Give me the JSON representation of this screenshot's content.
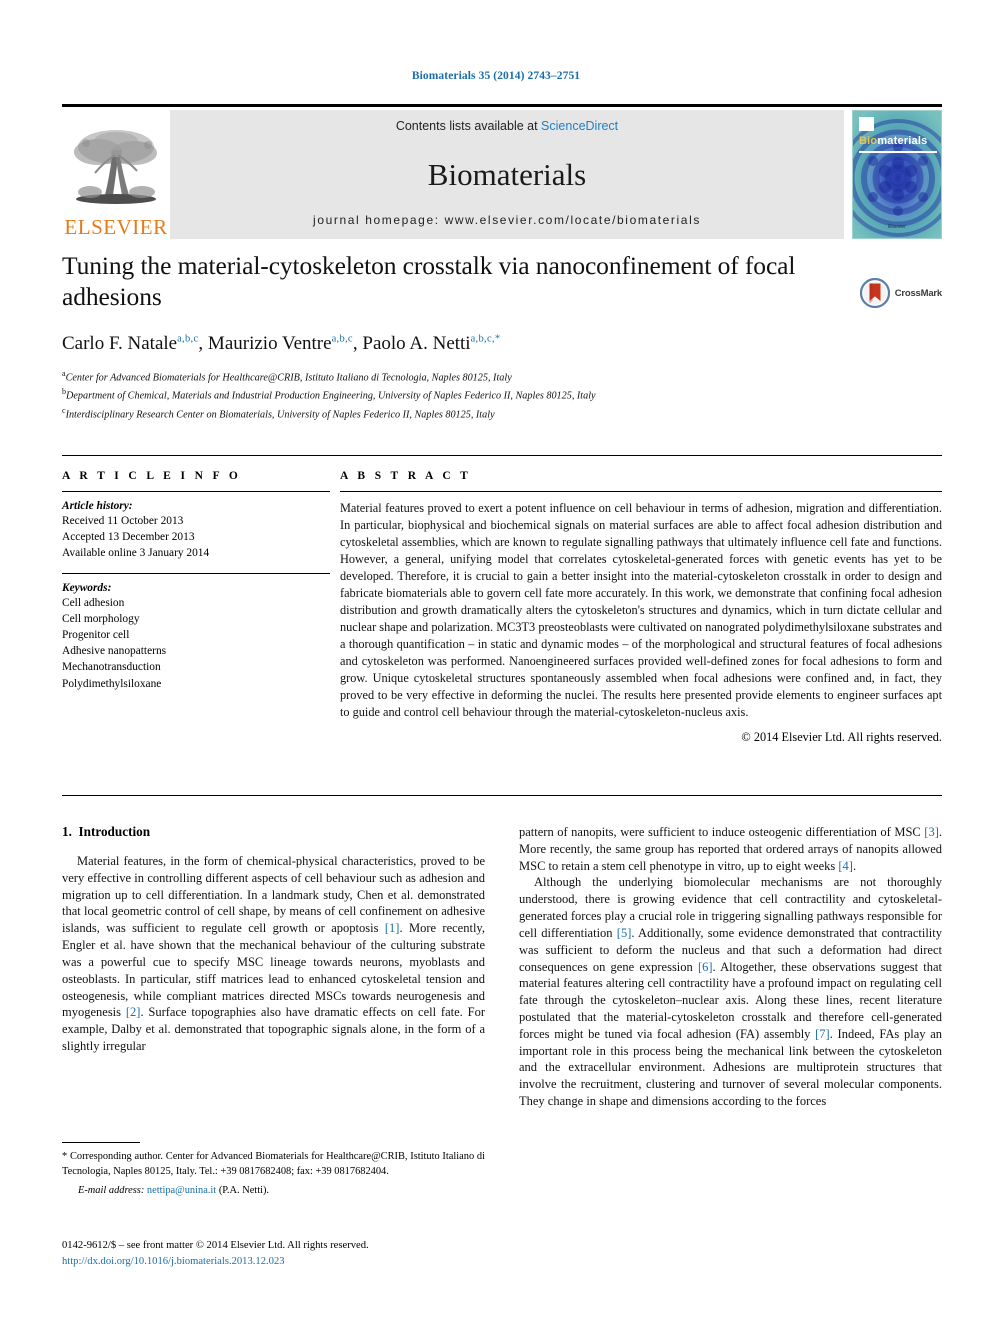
{
  "running_head": "Biomaterials 35 (2014) 2743–2751",
  "masthead": {
    "publisher": "ELSEVIER",
    "contents_prefix": "Contents lists available at ",
    "contents_link": "ScienceDirect",
    "journal_name": "Biomaterials",
    "homepage": "journal homepage: www.elsevier.com/locate/biomaterials",
    "cover": {
      "title_part1": "Bio",
      "title_part2": "materials",
      "footer": "Elsevier"
    }
  },
  "article": {
    "title": "Tuning the material-cytoskeleton crosstalk via nanoconfinement of focal adhesions",
    "crossmark_label": "CrossMark",
    "authors": [
      {
        "name": "Carlo F. Natale",
        "marks": "a,b,c",
        "sep": ", "
      },
      {
        "name": "Maurizio Ventre",
        "marks": "a,b,c",
        "sep": ", "
      },
      {
        "name": "Paolo A. Netti",
        "marks": "a,b,c,*",
        "sep": ""
      }
    ],
    "affiliations": [
      {
        "mark": "a",
        "text": "Center for Advanced Biomaterials for Healthcare@CRIB, Istituto Italiano di Tecnologia, Naples 80125, Italy"
      },
      {
        "mark": "b",
        "text": "Department of Chemical, Materials and Industrial Production Engineering, University of Naples Federico II, Naples 80125, Italy"
      },
      {
        "mark": "c",
        "text": "Interdisciplinary Research Center on Biomaterials, University of Naples Federico II, Naples 80125, Italy"
      }
    ]
  },
  "article_info": {
    "heading": "A R T I C L E  I N F O",
    "history_label": "Article history:",
    "history": [
      "Received 11 October 2013",
      "Accepted 13 December 2013",
      "Available online 3 January 2014"
    ],
    "keywords_label": "Keywords:",
    "keywords": [
      "Cell adhesion",
      "Cell morphology",
      "Progenitor cell",
      "Adhesive nanopatterns",
      "Mechanotransduction",
      "Polydimethylsiloxane"
    ]
  },
  "abstract": {
    "heading": "A B S T R A C T",
    "body": "Material features proved to exert a potent influence on cell behaviour in terms of adhesion, migration and differentiation. In particular, biophysical and biochemical signals on material surfaces are able to affect focal adhesion distribution and cytoskeletal assemblies, which are known to regulate signalling pathways that ultimately influence cell fate and functions. However, a general, unifying model that correlates cytoskeletal-generated forces with genetic events has yet to be developed. Therefore, it is crucial to gain a better insight into the material-cytoskeleton crosstalk in order to design and fabricate biomaterials able to govern cell fate more accurately. In this work, we demonstrate that confining focal adhesion distribution and growth dramatically alters the cytoskeleton's structures and dynamics, which in turn dictate cellular and nuclear shape and polarization. MC3T3 preosteoblasts were cultivated on nanograted polydimethylsiloxane substrates and a thorough quantification – in static and dynamic modes – of the morphological and structural features of focal adhesions and cytoskeleton was performed. Nanoengineered surfaces provided well-defined zones for focal adhesions to form and grow. Unique cytoskeletal structures spontaneously assembled when focal adhesions were confined and, in fact, they proved to be very effective in deforming the nuclei. The results here presented provide elements to engineer surfaces apt to guide and control cell behaviour through the material-cytoskeleton-nucleus axis.",
    "copyright": "© 2014 Elsevier Ltd. All rights reserved."
  },
  "introduction": {
    "section_number": "1.",
    "section_title": "Introduction",
    "left_paragraph_1_a": "Material features, in the form of chemical-physical characteristics, proved to be very effective in controlling different aspects of cell behaviour such as adhesion and migration up to cell differentiation. In a landmark study, Chen et al. demonstrated that local geometric control of cell shape, by means of cell confinement on adhesive islands, was sufficient to regulate cell growth or apoptosis ",
    "ref_1": "[1]",
    "left_paragraph_1_b": ". More recently, Engler et al. have shown that the mechanical behaviour of the culturing substrate was a powerful cue to specify MSC lineage towards neurons, myoblasts and osteoblasts. In particular, stiff matrices lead to enhanced cytoskeletal tension and osteogenesis, while compliant matrices directed MSCs towards neurogenesis and myogenesis ",
    "ref_2": "[2]",
    "left_paragraph_1_c": ". Surface topographies also have dramatic effects on cell fate. For example, Dalby et al. demonstrated that topographic signals alone, in the form of a slightly irregular",
    "right_paragraph_1_a": "pattern of nanopits, were sufficient to induce osteogenic differentiation of MSC ",
    "ref_3": "[3]",
    "right_paragraph_1_b": ". More recently, the same group has reported that ordered arrays of nanopits allowed MSC to retain a stem cell phenotype in vitro, up to eight weeks ",
    "ref_4": "[4]",
    "right_paragraph_1_c": ".",
    "right_paragraph_2_a": "Although the underlying biomolecular mechanisms are not thoroughly understood, there is growing evidence that cell contractility and cytoskeletal-generated forces play a crucial role in triggering signalling pathways responsible for cell differentiation ",
    "ref_5": "[5]",
    "right_paragraph_2_b": ". Additionally, some evidence demonstrated that contractility was sufficient to deform the nucleus and that such a deformation had direct consequences on gene expression ",
    "ref_6": "[6]",
    "right_paragraph_2_c": ". Altogether, these observations suggest that material features altering cell contractility have a profound impact on regulating cell fate through the cytoskeleton–nuclear axis. Along these lines, recent literature postulated that the material-cytoskeleton crosstalk and therefore cell-generated forces might be tuned via focal adhesion (FA) assembly ",
    "ref_7": "[7]",
    "right_paragraph_2_d": ". Indeed, FAs play an important role in this process being the mechanical link between the cytoskeleton and the extracellular environment. Adhesions are multiprotein structures that involve the recruitment, clustering and turnover of several molecular components. They change in shape and dimensions according to the forces"
  },
  "footnote": {
    "text": "* Corresponding author. Center for Advanced Biomaterials for Healthcare@CRIB, Istituto Italiano di Tecnologia, Naples 80125, Italy. Tel.: +39 0817682408; fax: +39 0817682404.",
    "email_label": "E-mail address:",
    "email": "nettipa@unina.it",
    "email_suffix": "(P.A. Netti)."
  },
  "colophon": {
    "issn_line": "0142-9612/$ – see front matter © 2014 Elsevier Ltd. All rights reserved.",
    "doi": "http://dx.doi.org/10.1016/j.biomaterials.2013.12.023"
  },
  "colors": {
    "link_blue": "#1a6ea8",
    "sciencedirect_blue": "#1f7ec4",
    "elsevier_orange": "#E87B19",
    "masthead_gray": "#e6e6e6",
    "cover_teal": "#6fb7b7",
    "crossmark_red": "#c8341f"
  }
}
